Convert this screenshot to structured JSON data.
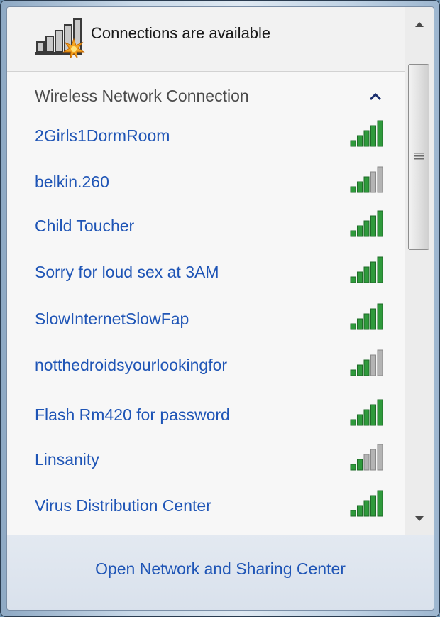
{
  "header": {
    "status_text": "Connections are available",
    "icon": "network-available-icon"
  },
  "section": {
    "title": "Wireless Network Connection",
    "collapse_icon": "chevron-up-icon"
  },
  "networks": [
    {
      "name": "2Girls1DormRoom",
      "signal_bars": 5
    },
    {
      "name": "belkin.260",
      "signal_bars": 3
    },
    {
      "name": "Child Toucher",
      "signal_bars": 5
    },
    {
      "name": "Sorry for loud sex at 3AM",
      "signal_bars": 5
    },
    {
      "name": "SlowInternetSlowFap",
      "signal_bars": 5
    },
    {
      "name": "notthedroidsyourlookingfor",
      "signal_bars": 3
    },
    {
      "name": "Flash Rm420 for password",
      "signal_bars": 5
    },
    {
      "name": "Linsanity",
      "signal_bars": 2
    },
    {
      "name": "Virus Distribution Center",
      "signal_bars": 5
    }
  ],
  "footer": {
    "link_label": "Open Network and Sharing Center"
  },
  "colors": {
    "link": "#1f55b6",
    "signal_on": "#2f9a3c",
    "signal_off": "#b4b4b4"
  }
}
